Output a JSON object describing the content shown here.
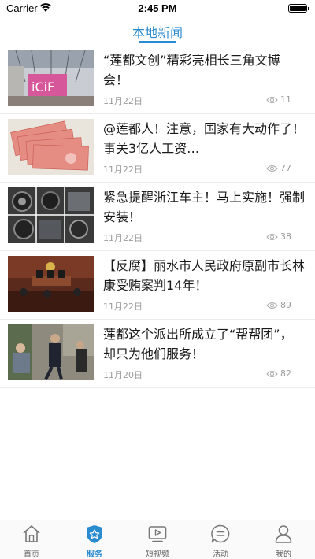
{
  "status": {
    "carrier": "Carrier",
    "time": "2:45 PM"
  },
  "nav": {
    "title": "本地新闻"
  },
  "news": [
    {
      "title": "“莲都文创”精彩亮相长三角文博会！",
      "date": "11月22日",
      "views": "11"
    },
    {
      "title": "@莲都人！注意，国家有大动作了！事关3亿人工资…",
      "date": "11月22日",
      "views": "77"
    },
    {
      "title": "紧急提醒浙江车主！马上实施！强制安装！",
      "date": "11月22日",
      "views": "38"
    },
    {
      "title": "【反腐】丽水市人民政府原副市长林康受贿案判14年！",
      "date": "11月22日",
      "views": "89"
    },
    {
      "title": "莲都这个派出所成立了“帮帮团”，却只为他们服务！",
      "date": "11月20日",
      "views": "82"
    }
  ],
  "tabs": [
    {
      "label": "首页",
      "icon": "home-icon",
      "active": false
    },
    {
      "label": "服务",
      "icon": "service-shield-icon",
      "active": true
    },
    {
      "label": "短视频",
      "icon": "video-icon",
      "active": false
    },
    {
      "label": "活动",
      "icon": "activity-chat-icon",
      "active": false
    },
    {
      "label": "我的",
      "icon": "profile-icon",
      "active": false
    }
  ],
  "colors": {
    "accent": "#2a8bd0",
    "meta": "#9a9a9a"
  }
}
